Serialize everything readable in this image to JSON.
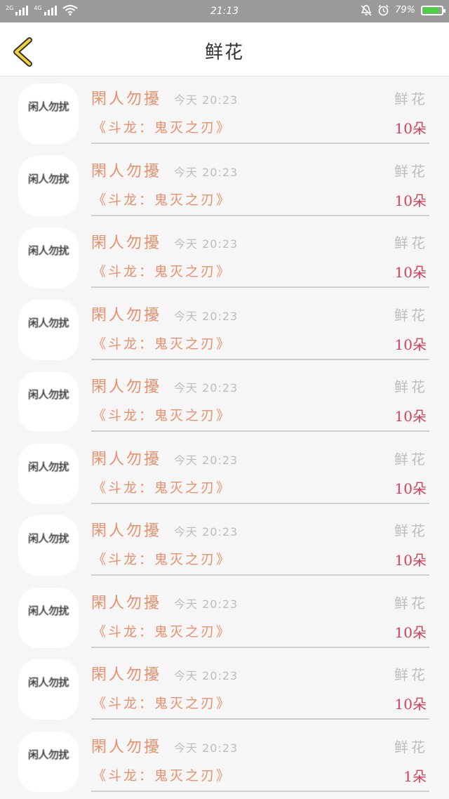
{
  "status_bar": {
    "sim1_label": "2G",
    "sim2_label": "4G",
    "time": "21:13",
    "battery_percent": "79%",
    "battery_level": 0.79,
    "battery_color": "#47d33c"
  },
  "header": {
    "back_icon": "chevron-left-icon",
    "title": "鲜花"
  },
  "colors": {
    "accent_orange": "#e8906c",
    "count_red": "#d4405a",
    "muted_gray": "#bdbdbd"
  },
  "items": [
    {
      "avatar_text": "闲人勿扰",
      "name": "閑人勿擾",
      "time": "今天 20:23",
      "gift": "鲜花",
      "work": "《斗龙：鬼灭之刃》",
      "count": "10朵"
    },
    {
      "avatar_text": "闲人勿扰",
      "name": "閑人勿擾",
      "time": "今天 20:23",
      "gift": "鲜花",
      "work": "《斗龙：鬼灭之刃》",
      "count": "10朵"
    },
    {
      "avatar_text": "闲人勿扰",
      "name": "閑人勿擾",
      "time": "今天 20:23",
      "gift": "鲜花",
      "work": "《斗龙：鬼灭之刃》",
      "count": "10朵"
    },
    {
      "avatar_text": "闲人勿扰",
      "name": "閑人勿擾",
      "time": "今天 20:23",
      "gift": "鲜花",
      "work": "《斗龙：鬼灭之刃》",
      "count": "10朵"
    },
    {
      "avatar_text": "闲人勿扰",
      "name": "閑人勿擾",
      "time": "今天 20:23",
      "gift": "鲜花",
      "work": "《斗龙：鬼灭之刃》",
      "count": "10朵"
    },
    {
      "avatar_text": "闲人勿扰",
      "name": "閑人勿擾",
      "time": "今天 20:23",
      "gift": "鲜花",
      "work": "《斗龙：鬼灭之刃》",
      "count": "10朵"
    },
    {
      "avatar_text": "闲人勿扰",
      "name": "閑人勿擾",
      "time": "今天 20:23",
      "gift": "鲜花",
      "work": "《斗龙：鬼灭之刃》",
      "count": "10朵"
    },
    {
      "avatar_text": "闲人勿扰",
      "name": "閑人勿擾",
      "time": "今天 20:23",
      "gift": "鲜花",
      "work": "《斗龙：鬼灭之刃》",
      "count": "10朵"
    },
    {
      "avatar_text": "闲人勿扰",
      "name": "閑人勿擾",
      "time": "今天 20:23",
      "gift": "鲜花",
      "work": "《斗龙：鬼灭之刃》",
      "count": "10朵"
    },
    {
      "avatar_text": "闲人勿扰",
      "name": "閑人勿擾",
      "time": "今天 20:23",
      "gift": "鲜花",
      "work": "《斗龙：鬼灭之刃》",
      "count": "1朵"
    }
  ]
}
